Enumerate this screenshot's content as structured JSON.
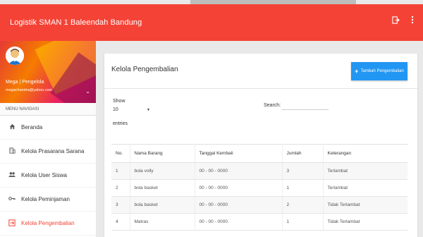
{
  "app": {
    "title": "Logistik SMAN 1 Baleendah Bandung"
  },
  "topbar": {
    "logout_icon": "logout-icon",
    "more_icon": "more-vert-icon",
    "accent": "#f44336"
  },
  "profile": {
    "name": "Mega | Pengelola",
    "email": "megachandra@yahoo.com"
  },
  "menu": {
    "header": "MENU NAVIGASI",
    "items": [
      {
        "label": "Beranda",
        "icon": "home-icon"
      },
      {
        "label": "Kelola Prasarana Sarana",
        "icon": "building-icon"
      },
      {
        "label": "Kelola User Siswa",
        "icon": "people-icon"
      },
      {
        "label": "Kelola Peminjaman",
        "icon": "key-icon"
      },
      {
        "label": "Kelola Pengembalian",
        "icon": "return-icon",
        "active": true
      }
    ]
  },
  "content": {
    "title": "Kelola Pengembalian",
    "add_button": "Tambah Pengembalian",
    "show_label": "Show",
    "entries_value": "10",
    "entries_label": "entries",
    "search_label": "Search:",
    "search_value": "",
    "table": {
      "columns": [
        "No.",
        "Nama Barang",
        "Tanggal Kembali",
        "Jumlah",
        "Keterangan"
      ],
      "rows": [
        [
          "1",
          "bola volly",
          "00 - 00 - 0000",
          "3",
          "Terlambat"
        ],
        [
          "2",
          "bola basket",
          "00 - 00 - 0000",
          "1",
          "Terlambat"
        ],
        [
          "3",
          "bola basket",
          "00 - 00 - 0000",
          "2",
          "Tidak Terlambat"
        ],
        [
          "4",
          "Matras",
          "00 - 00 - 0000",
          "1",
          "Tidak Terlambat"
        ]
      ]
    }
  }
}
